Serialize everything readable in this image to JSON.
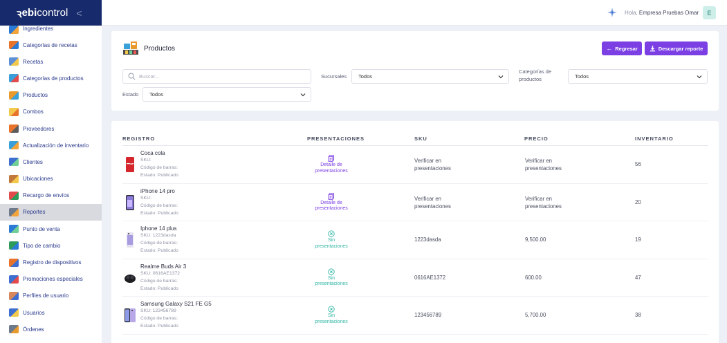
{
  "brand": {
    "mark": "ꝛ",
    "prefix": "ebi",
    "suffix": "control",
    "collapse": "<"
  },
  "colors": {
    "sidebar_brand_bg": "#172a6b",
    "accent": "#7b3fe4",
    "teal": "#30b6a3"
  },
  "sidebar": {
    "items": [
      {
        "label": "Ingredientes",
        "icon": "ingredients-icon"
      },
      {
        "label": "Categorías de recetas",
        "icon": "recipe-categories-icon"
      },
      {
        "label": "Recetas",
        "icon": "recipes-icon"
      },
      {
        "label": "Categorías de productos",
        "icon": "product-categories-icon"
      },
      {
        "label": "Productos",
        "icon": "products-icon"
      },
      {
        "label": "Combos",
        "icon": "combos-icon"
      },
      {
        "label": "Proveedores",
        "icon": "suppliers-icon"
      },
      {
        "label": "Actualización de inventario",
        "icon": "inventory-update-icon"
      },
      {
        "label": "Clientes",
        "icon": "clients-icon"
      },
      {
        "label": "Ubicaciones",
        "icon": "locations-icon"
      },
      {
        "label": "Recargo de envíos",
        "icon": "shipping-surcharge-icon"
      },
      {
        "label": "Reportes",
        "icon": "reports-icon",
        "active": true
      },
      {
        "label": "Punto de venta",
        "icon": "point-of-sale-icon"
      },
      {
        "label": "Tipo de cambio",
        "icon": "exchange-rate-icon"
      },
      {
        "label": "Registro de dispositivos",
        "icon": "device-registry-icon"
      },
      {
        "label": "Promociones especiales",
        "icon": "promotions-icon"
      },
      {
        "label": "Perfiles de usuario",
        "icon": "user-profiles-icon"
      },
      {
        "label": "Usuarios",
        "icon": "users-icon"
      },
      {
        "label": "Órdenes",
        "icon": "orders-icon"
      }
    ]
  },
  "topbar": {
    "greeting": "Hola,",
    "company": "Empresa Pruebas Omar",
    "avatar": "E"
  },
  "page": {
    "title": "Productos",
    "back_label": "Regresar",
    "download_label": "Descargar reporte"
  },
  "filters": {
    "search_placeholder": "Buscar...",
    "sucursales_label": "Sucursales",
    "sucursales_value": "Todos",
    "categorias_label_1": "Categorías de",
    "categorias_label_2": "productos",
    "categorias_value": "Todos",
    "estado_label": "Estado",
    "estado_value": "Todos"
  },
  "table": {
    "headers": [
      "REGISTRO",
      "PRESENTACIONES",
      "SKU",
      "PRECIO",
      "INVENTARIO"
    ],
    "rows": [
      {
        "name": "Coca cola",
        "sku": "SKU:",
        "barcode": "Código de barras:",
        "status": "Estado: Publicado",
        "pres_1": "Detalle de",
        "pres_2": "presentaciones",
        "has_pres": true,
        "sku_1": "Verificar en",
        "sku_2": "presentaciones",
        "price_1": "Verificar en",
        "price_2": "presentaciones",
        "inventory": "56"
      },
      {
        "name": "iPhone 14 pro",
        "sku": "SKU:",
        "barcode": "Código de barras:",
        "status": "Estado: Publicado",
        "pres_1": "Detalle de",
        "pres_2": "presentaciones",
        "has_pres": true,
        "sku_1": "Verificar en",
        "sku_2": "presentaciones",
        "price_1": "Verificar en",
        "price_2": "presentaciones",
        "inventory": "20"
      },
      {
        "name": "Iphone 14 plus",
        "sku": "SKU: 1223dasda",
        "barcode": "Código de barras:",
        "status": "Estado: Publicado",
        "pres_1": "Sin",
        "pres_2": "presentaciones",
        "has_pres": false,
        "sku_1": "1223dasda",
        "sku_2": "",
        "price_1": "9,500.00",
        "price_2": "",
        "inventory": "19"
      },
      {
        "name": "Realme Buds Air 3",
        "sku": "SKU: 0616AE1372",
        "barcode": "Código de barras:",
        "status": "Estado: Publicado",
        "pres_1": "Sin",
        "pres_2": "presentaciones",
        "has_pres": false,
        "sku_1": "0616AE1372",
        "sku_2": "",
        "price_1": "600.00",
        "price_2": "",
        "inventory": "47"
      },
      {
        "name": "Samsung Galaxy S21 FE G5",
        "sku": "SKU: 123456789",
        "barcode": "Código de barras:",
        "status": "Estado: Publicado",
        "pres_1": "Sin",
        "pres_2": "presentaciones",
        "has_pres": false,
        "sku_1": "123456789",
        "sku_2": "",
        "price_1": "5,700.00",
        "price_2": "",
        "inventory": "38"
      }
    ]
  }
}
